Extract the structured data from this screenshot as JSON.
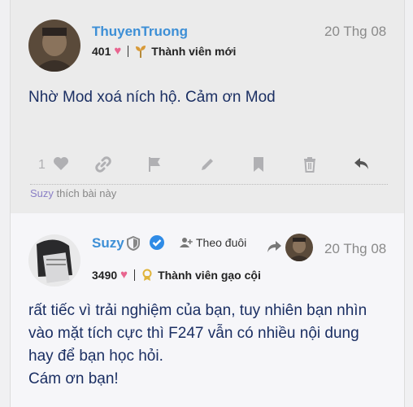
{
  "post1": {
    "username": "ThuyenTruong",
    "date": "20 Thg 08",
    "likes_received": "401",
    "rank": "Thành viên mới",
    "body": "Nhờ Mod xoá ních hộ. Cảm ơn Mod",
    "like_count": "1",
    "liked_by_user": "Suzy",
    "liked_by_suffix": "thích bài này"
  },
  "post2": {
    "username": "Suzy",
    "follow_label": "Theo đuôi",
    "date": "20 Thg 08",
    "likes_received": "3490",
    "rank": "Thành viên gạo cội",
    "body_lines": [
      "rất tiếc vì trải nghiệm của bạn, tuy nhiên bạn nhìn",
      "vào mặt tích cực thì F247 vẫn có nhiều nội dung",
      "hay để bạn học hỏi.",
      "Cám ơn bạn!"
    ]
  },
  "colors": {
    "username": "#3d8fd6",
    "heart": "#e8658f",
    "body_text": "#1b2f63",
    "verified": "#2f8be6"
  },
  "icons": [
    "heart-icon",
    "link-icon",
    "flag-icon",
    "pencil-icon",
    "bookmark-icon",
    "trash-icon",
    "reply-icon",
    "shield-icon",
    "verified-icon",
    "follow-icon",
    "award-icon"
  ]
}
